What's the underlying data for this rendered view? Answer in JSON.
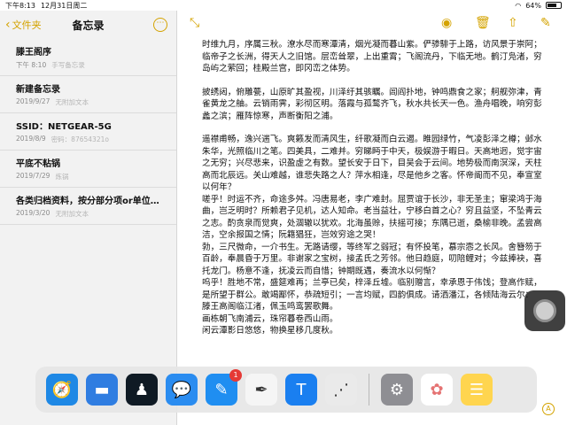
{
  "status": {
    "time": "下午8:13",
    "date": "12月31日周二",
    "battery": "64%"
  },
  "sidebar": {
    "back_label": "文件夹",
    "title": "备忘录",
    "notes": [
      {
        "title": "滕王阁序",
        "date": "下午 8:10",
        "preview": "手写备忘录"
      },
      {
        "title": "新建备忘录",
        "date": "2019/9/27",
        "preview": "无附加文本"
      },
      {
        "title": "SSID：NETGEAR-5G",
        "date": "2019/8/9",
        "preview": "密码：87654321o"
      },
      {
        "title": "平底不粘锅",
        "date": "2019/7/29",
        "preview": "炼锅"
      },
      {
        "title": "各类归档资料，按分部分项or单位…",
        "date": "2019/3/20",
        "preview": "无附加文本"
      }
    ]
  },
  "note": {
    "p1": "时维九月，序属三秋。潦水尽而寒潭清，烟光凝而暮山紫。俨骖騑于上路，访风景于崇阿；临帝子之长洲，得天人之旧馆。层峦耸翠，上出重霄；飞阁流丹，下临无地。鹤汀凫渚，穷岛屿之萦回；桂殿兰宫，即冈峦之体势。",
    "p2": "披绣闼，俯雕甍，山原旷其盈视，川泽纡其骇瞩。闾阎扑地，钟鸣鼎食之家；舸舰弥津，青雀黄龙之舳。云销雨霁，彩彻区明。落霞与孤鹜齐飞，秋水共长天一色。渔舟唱晚，响穷彭蠡之滨；雁阵惊寒，声断衡阳之浦。",
    "p3": "遥襟甫畅，逸兴遄飞。爽籁发而清风生，纤歌凝而白云遏。睢园绿竹，气凌彭泽之樽；邺水朱华，光照临川之笔。四美具，二难并。穷睇眄于中天，极娱游于暇日。天高地迥，觉宇宙之无穷；兴尽悲来，识盈虚之有数。望长安于日下，目吴会于云间。地势极而南溟深，天柱高而北辰远。关山难越，谁悲失路之人？萍水相逢，尽是他乡之客。怀帝阍而不见，奉宣室以何年？",
    "p4": "嗟乎！时运不齐，命途多舛。冯唐易老，李广难封。屈贾谊于长沙，非无圣主；窜梁鸿于海曲，岂乏明时？所赖君子见机，达人知命。老当益壮，宁移白首之心？穷且益坚，不坠青云之志。酌贪泉而觉爽，处涸辙以犹欢。北海虽赊，扶摇可接；东隅已逝，桑榆非晚。孟尝高洁，空余报国之情；阮籍猖狂，岂效穷途之哭！",
    "p5": "勃，三尺微命，一介书生。无路请缨，等终军之弱冠；有怀投笔，慕宗悫之长风。舍簪笏于百龄，奉晨昏于万里。非谢家之宝树，接孟氏之芳邻。他日趋庭，叨陪鲤对；今兹捧袂，喜托龙门。杨意不逢，抚凌云而自惜；钟期既遇，奏流水以何惭？",
    "p6": "呜乎！胜地不常，盛筵难再；兰亭已矣，梓泽丘墟。临别赠言，幸承恩于伟饯；登高作赋，是所望于群公。敢竭鄙怀，恭疏短引；一言均赋，四韵俱成。请洒潘江，各倾陆海云尔：",
    "l1": "滕王高阁临江渚，佩玉鸣鸾罢歌舞。",
    "l2": "画栋朝飞南浦云，珠帘暮卷西山雨。",
    "l3": "闲云潭影日悠悠，物换星移几度秋。"
  },
  "dock": {
    "apps": [
      {
        "name": "Safari",
        "icon": "compass-icon",
        "color": "#1e88e5"
      },
      {
        "name": "文件",
        "icon": "folder-icon",
        "color": "#2f7de1"
      },
      {
        "name": "Kindle",
        "icon": "reader-icon",
        "color": "#0f1a24"
      },
      {
        "name": "信息",
        "icon": "chat-icon",
        "color": "#2a8cf0"
      },
      {
        "name": "Pages",
        "icon": "pen-icon",
        "color": "#1f8ef1",
        "badge": "1"
      },
      {
        "name": "书写",
        "icon": "pencil-icon",
        "color": "#f5f5f5"
      },
      {
        "name": "TapTap",
        "icon": "tap-icon",
        "color": "#1a7ff0"
      },
      {
        "name": "流程",
        "icon": "nodes-icon",
        "color": "#eaeaea"
      },
      {
        "name": "设置",
        "icon": "gear-icon",
        "color": "#8e8e93"
      },
      {
        "name": "照片",
        "icon": "flower-icon",
        "color": "#ffffff"
      },
      {
        "name": "备忘录",
        "icon": "notes-icon",
        "color": "#ffd54f"
      }
    ]
  }
}
